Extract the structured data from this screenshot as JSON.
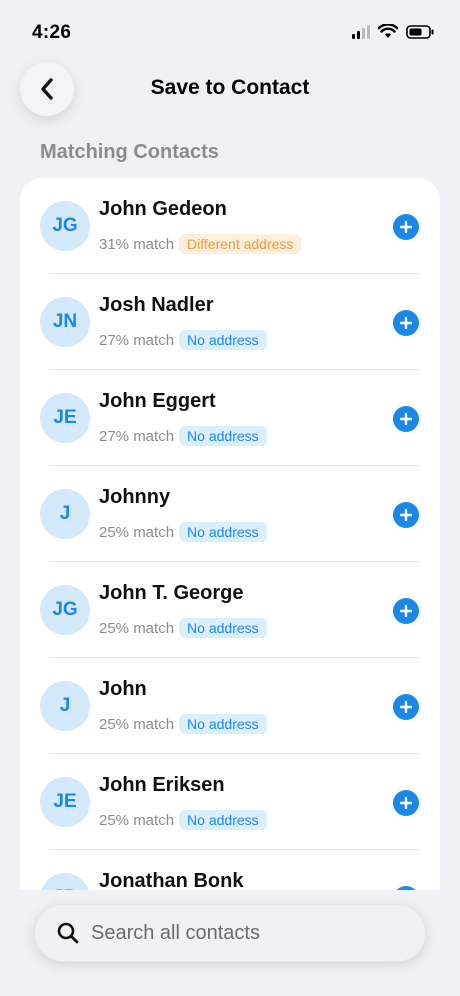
{
  "status_bar": {
    "time": "4:26"
  },
  "header": {
    "title": "Save to Contact"
  },
  "section": {
    "title": "Matching Contacts"
  },
  "contacts": [
    {
      "initials": "JG",
      "name": "John Gedeon",
      "match": "31% match",
      "badge": "Different address",
      "badge_color": "orange"
    },
    {
      "initials": "JN",
      "name": "Josh Nadler",
      "match": "27% match",
      "badge": "No address",
      "badge_color": "blue"
    },
    {
      "initials": "JE",
      "name": "John Eggert",
      "match": "27% match",
      "badge": "No address",
      "badge_color": "blue"
    },
    {
      "initials": "J",
      "name": "Johnny",
      "match": "25% match",
      "badge": "No address",
      "badge_color": "blue"
    },
    {
      "initials": "JG",
      "name": "John T. George",
      "match": "25% match",
      "badge": "No address",
      "badge_color": "blue"
    },
    {
      "initials": "J",
      "name": "John",
      "match": "25% match",
      "badge": "No address",
      "badge_color": "blue"
    },
    {
      "initials": "JE",
      "name": "John Eriksen",
      "match": "25% match",
      "badge": "No address",
      "badge_color": "blue"
    },
    {
      "initials": "JB",
      "name": "Jonathan Bonk",
      "match": "",
      "badge": "",
      "badge_color": "blue"
    }
  ],
  "search": {
    "placeholder": "Search all contacts"
  },
  "colors": {
    "accent": "#1a88e8",
    "avatar_bg": "#d3e8fb",
    "badge_orange": "#ef9a3c"
  }
}
